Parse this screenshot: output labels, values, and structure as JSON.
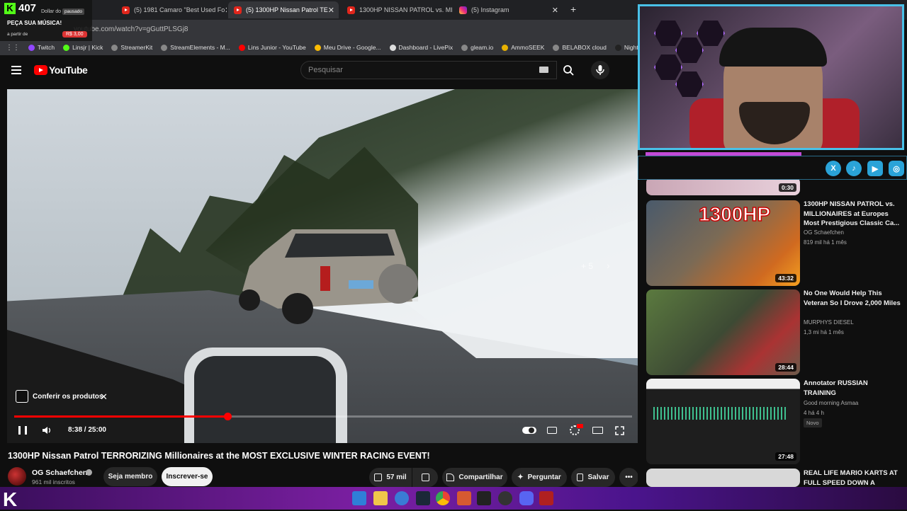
{
  "browser": {
    "tabs": [
      {
        "label": "(5) 1981 Camaro \"Best Used Fo"
      },
      {
        "label": "(5) 1300HP Nissan Patrol TE"
      },
      {
        "label": "1300HP NISSAN PATROL vs. MI"
      },
      {
        "label": "(5) Instagram"
      }
    ],
    "url": "youtube.com/watch?v=gGuttPLSGj8",
    "bookmarks": [
      "Twitch",
      "Linsjr | Kick",
      "StreamerKit",
      "StreamElements - M...",
      "Lins Junior - YouTube",
      "Meu Drive - Google...",
      "Dashboard - LivePix",
      "gleam.io",
      "AmmoSEEK",
      "BELABOX cloud",
      "Nightbot - Comm"
    ]
  },
  "overlay": {
    "viewer_count": "407",
    "name": "Dollar do Rhyno",
    "status": "pausado",
    "promo": "PEÇA SUA MÚSICA!",
    "price_prefix": "a partir de",
    "price": "R$ 3,00"
  },
  "youtube": {
    "logo_text": "YouTube",
    "search_placeholder": "Pesquisar"
  },
  "player": {
    "plus_count": "+ 5",
    "products_chip": "Conferir os produtos",
    "time_current": "8:38",
    "time_total": "25:00",
    "progress_fraction": 0.345
  },
  "video": {
    "title": "1300HP Nissan Patrol TERRORIZING Millionaires at the MOST EXCLUSIVE WINTER RACING EVENT!",
    "channel": "OG Schaefchen",
    "subscribers": "961 mil inscritos",
    "join_label": "Seja membro",
    "subscribe_label": "Inscrever-se",
    "likes": "57 mil",
    "share_label": "Compartilhar",
    "ask_label": "Perguntar",
    "save_label": "Salvar"
  },
  "recommendations": [
    {
      "duration": "0:30"
    },
    {
      "title": "1300HP NISSAN PATROL vs. MILLIONAIRES at Europes Most Prestigious Classic Ca...",
      "channel": "OG Schaefchen",
      "meta": "819 mil   há 1 mês",
      "duration": "43:32",
      "thumb_text": "1300HP"
    },
    {
      "title": "No One Would Help This Veteran So I Drove 2,000 Miles",
      "channel": "MURPHYS DIESEL",
      "meta": "1,3 mi   há 1 mês",
      "duration": "28:44"
    },
    {
      "title": "Annotator  RUSSIAN TRAINING",
      "channel": "Good morning Asmaa",
      "meta": "4   há 4 h",
      "badge": "Novo",
      "duration": "27:48"
    },
    {
      "title": "REAL LIFE MARIO KARTS AT FULL SPEED DOWN A"
    }
  ],
  "colors": {
    "accent": "#ff0000",
    "webcam_border": "#49c1e8",
    "bg": "#0f0f0f"
  }
}
